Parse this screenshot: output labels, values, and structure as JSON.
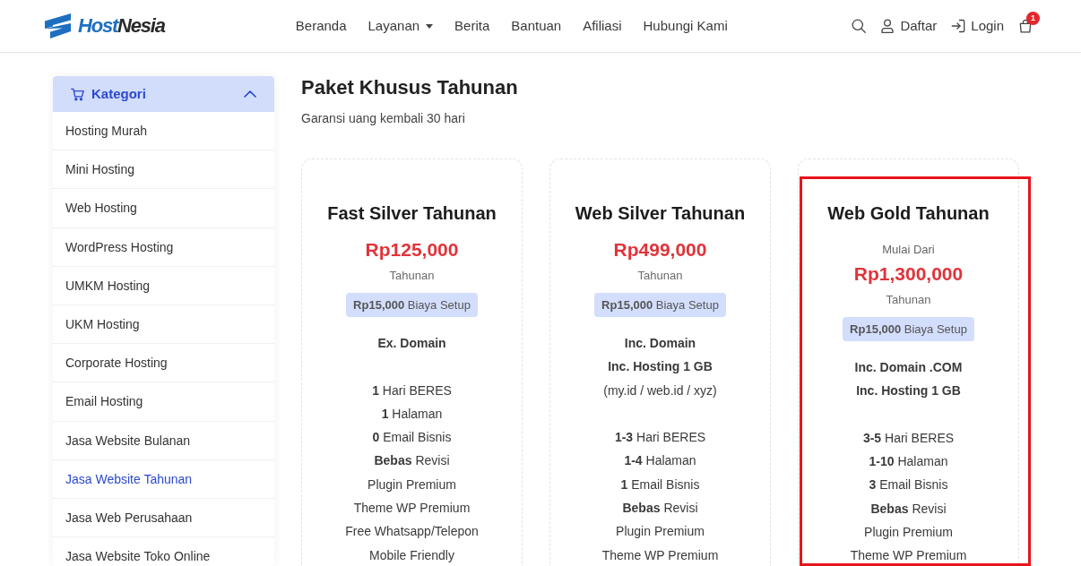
{
  "header": {
    "logo": {
      "part_1": "Host",
      "part_2": "Nesia"
    },
    "nav": [
      {
        "label": "Beranda",
        "dropdown": false
      },
      {
        "label": "Layanan",
        "dropdown": true
      },
      {
        "label": "Berita",
        "dropdown": false
      },
      {
        "label": "Bantuan",
        "dropdown": false
      },
      {
        "label": "Afiliasi",
        "dropdown": false
      },
      {
        "label": "Hubungi Kami",
        "dropdown": false
      }
    ],
    "actions": [
      {
        "kind": "search"
      },
      {
        "kind": "register",
        "label": "Daftar"
      },
      {
        "kind": "login",
        "label": "Login"
      },
      {
        "kind": "cart",
        "badge": "1"
      }
    ]
  },
  "sidebar": {
    "title": "Kategori",
    "expanded": true,
    "items": [
      {
        "label": "Hosting Murah",
        "selected": false
      },
      {
        "label": "Mini Hosting",
        "selected": false
      },
      {
        "label": "Web Hosting",
        "selected": false
      },
      {
        "label": "WordPress Hosting",
        "selected": false
      },
      {
        "label": "UMKM Hosting",
        "selected": false
      },
      {
        "label": "UKM Hosting",
        "selected": false
      },
      {
        "label": "Corporate Hosting",
        "selected": false
      },
      {
        "label": "Email Hosting",
        "selected": false
      },
      {
        "label": "Jasa Website Bulanan",
        "selected": false
      },
      {
        "label": "Jasa Website Tahunan",
        "selected": true
      },
      {
        "label": "Jasa Web Perusahaan",
        "selected": false
      },
      {
        "label": "Jasa Website Toko Online",
        "selected": false
      }
    ]
  },
  "main": {
    "title": "Paket Khusus Tahunan",
    "subtitle": "Garansi uang kembali 30 hari"
  },
  "plans": [
    {
      "name": "Fast Silver Tahunan",
      "price": "Rp125,000",
      "period": "Tahunan",
      "setup_fee": "**Rp15,000** Biaya Setup",
      "includes": [
        {
          "text": "Ex. Domain",
          "bold": true
        }
      ],
      "features": [
        "**1** Hari BERES",
        "**1** Halaman",
        "**0** Email Bisnis",
        "**Bebas** Revisi",
        "Plugin Premium",
        "Theme WP Premium",
        "Free Whatsapp/Telepon",
        "Mobile Friendly"
      ],
      "highlighted": false
    },
    {
      "name": "Web Silver Tahunan",
      "price": "Rp499,000",
      "period": "Tahunan",
      "setup_fee": "**Rp15,000** Biaya Setup",
      "includes": [
        {
          "text": "Inc. Domain",
          "bold": true
        },
        {
          "text": "Inc. Hosting 1 GB",
          "bold": true
        },
        {
          "text": "(my.id / web.id / xyz)",
          "bold": false
        }
      ],
      "features": [
        "**1-3** Hari BERES",
        "**1-4** Halaman",
        "**1** Email Bisnis",
        "**Bebas** Revisi",
        "Plugin Premium",
        "Theme WP Premium"
      ],
      "highlighted": false
    },
    {
      "name": "Web Gold Tahunan",
      "price_prefix": "Mulai Dari",
      "price": "Rp1,300,000",
      "period": "Tahunan",
      "setup_fee": "**Rp15,000** Biaya Setup",
      "includes": [
        {
          "text": "Inc. Domain .COM",
          "bold": true
        },
        {
          "text": "Inc. Hosting 1 GB",
          "bold": true
        }
      ],
      "features": [
        "**3-5** Hari BERES",
        "**1-10** Halaman",
        "**3** Email Bisnis",
        "**Bebas** Revisi",
        "Plugin Premium",
        "Theme WP Premium"
      ],
      "highlighted": true
    }
  ]
}
